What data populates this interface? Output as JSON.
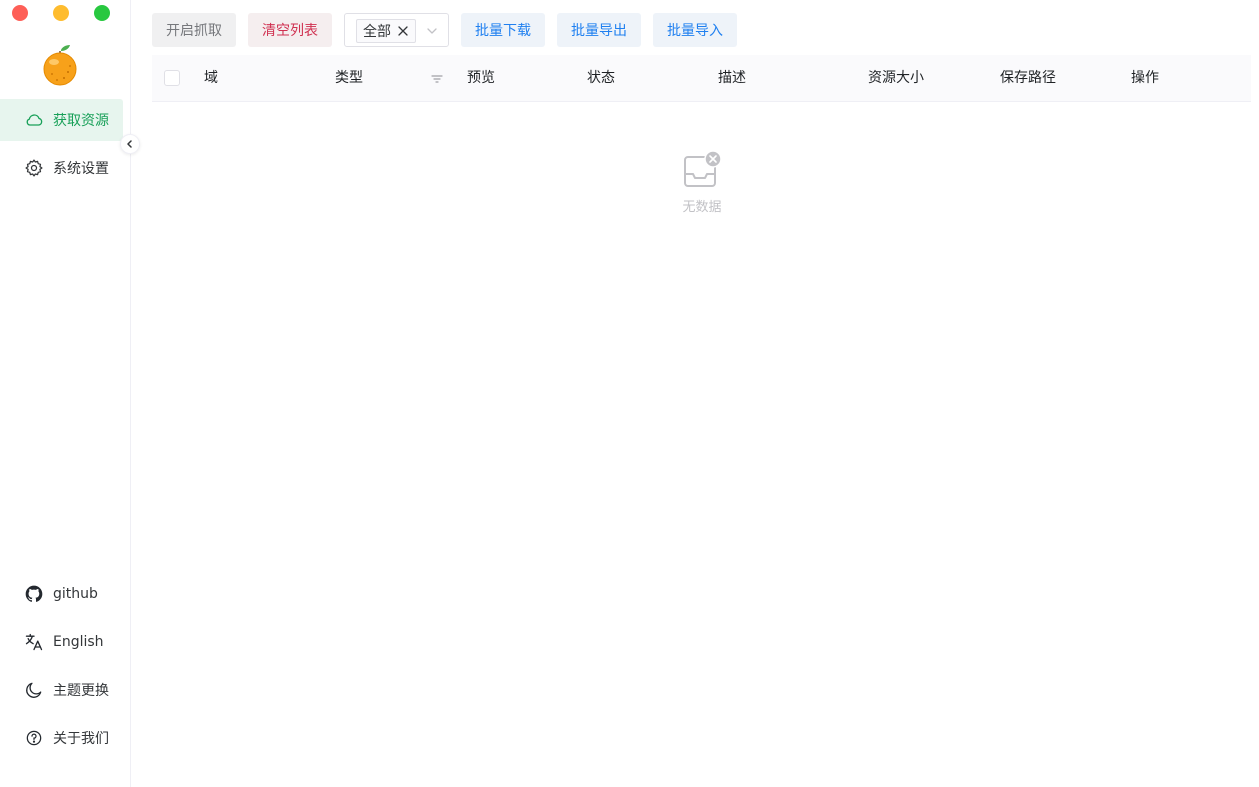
{
  "sidebar": {
    "nav": [
      {
        "label": "获取资源",
        "icon": "cloud-icon",
        "active": true
      },
      {
        "label": "系统设置",
        "icon": "gear-icon",
        "active": false
      }
    ],
    "bottom": [
      {
        "label": "github",
        "icon": "github-icon"
      },
      {
        "label": "English",
        "icon": "translate-icon"
      },
      {
        "label": "主题更换",
        "icon": "moon-icon"
      },
      {
        "label": "关于我们",
        "icon": "help-circle-icon"
      }
    ]
  },
  "toolbar": {
    "start_capture": "开启抓取",
    "clear_list": "清空列表",
    "filter_tag": "全部",
    "batch_download": "批量下载",
    "batch_export": "批量导出",
    "batch_import": "批量导入"
  },
  "table": {
    "columns": [
      "域",
      "类型",
      "预览",
      "状态",
      "描述",
      "资源大小",
      "保存路径",
      "操作"
    ],
    "empty_text": "无数据"
  },
  "colors": {
    "accent": "#18a058",
    "danger": "#d03050",
    "info": "#2080f0"
  }
}
